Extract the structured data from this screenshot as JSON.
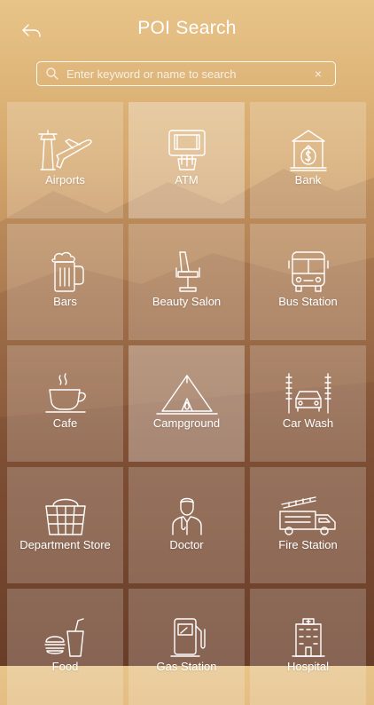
{
  "header": {
    "title": "POI Search",
    "back_icon": "back-arrow-icon"
  },
  "search": {
    "placeholder": "Enter keyword or name to search",
    "value": "",
    "search_icon": "magnifier-icon",
    "clear_label": "×"
  },
  "categories": [
    {
      "label": "Airports",
      "icon": "airport-icon"
    },
    {
      "label": "ATM",
      "icon": "atm-icon"
    },
    {
      "label": "Bank",
      "icon": "bank-icon"
    },
    {
      "label": "Bars",
      "icon": "beer-mug-icon"
    },
    {
      "label": "Beauty Salon",
      "icon": "salon-chair-icon"
    },
    {
      "label": "Bus Station",
      "icon": "bus-icon"
    },
    {
      "label": "Cafe",
      "icon": "coffee-cup-icon"
    },
    {
      "label": "Campground",
      "icon": "tent-icon"
    },
    {
      "label": "Car Wash",
      "icon": "car-wash-icon"
    },
    {
      "label": "Department Store",
      "icon": "shopping-basket-icon"
    },
    {
      "label": "Doctor",
      "icon": "doctor-icon"
    },
    {
      "label": "Fire Station",
      "icon": "fire-truck-icon"
    },
    {
      "label": "Food",
      "icon": "fast-food-icon"
    },
    {
      "label": "Gas Station",
      "icon": "fuel-pump-icon"
    },
    {
      "label": "Hospital",
      "icon": "hospital-icon"
    }
  ]
}
